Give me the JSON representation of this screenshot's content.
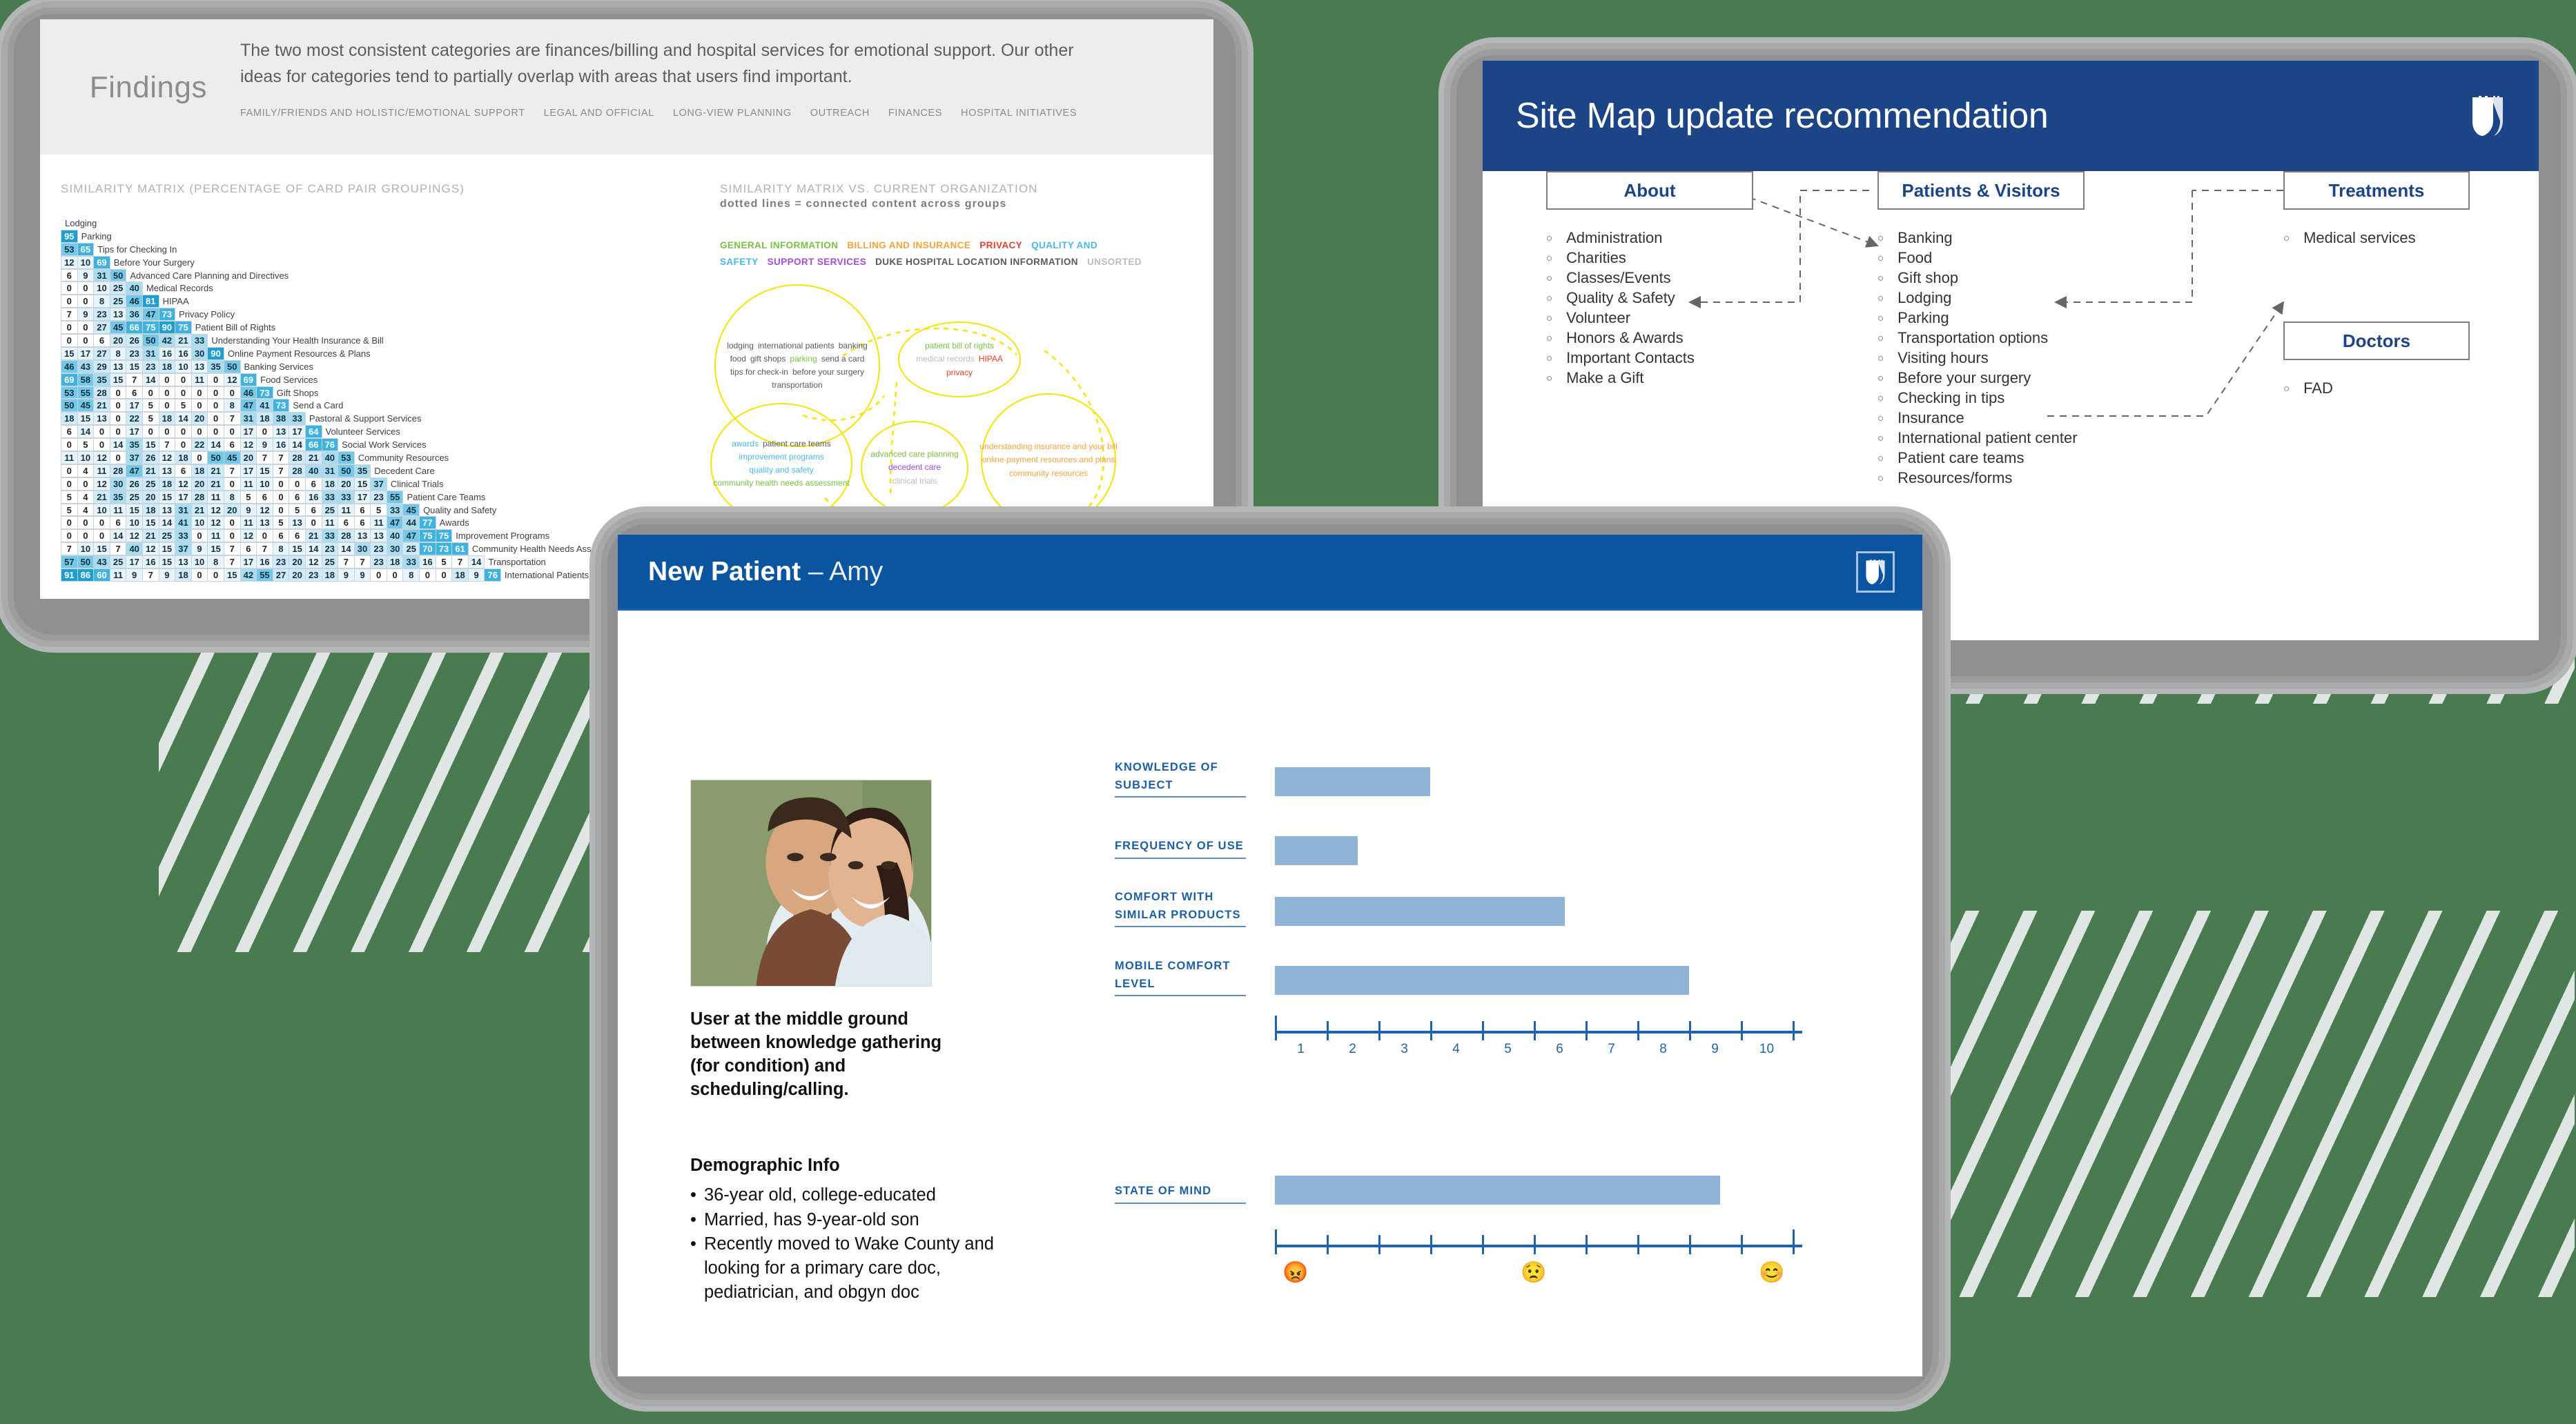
{
  "background": {
    "color": "#4a7a50",
    "stripe_color": "#ebeeee"
  },
  "panels": {
    "findings": {
      "title": "Findings",
      "paragraph": "The two most consistent categories are finances/billing and hospital services for emotional support. Our other ideas for categories tend to partially overlap with areas that users find important.",
      "categories": [
        "FAMILY/FRIENDS AND HOLISTIC/EMOTIONAL SUPPORT",
        "LEGAL AND OFFICIAL",
        "LONG-VIEW PLANNING",
        "OUTREACH",
        "FINANCES",
        "HOSPITAL INITIATIVES"
      ],
      "matrix_title": "SIMILARITY MATRIX (PERCENTAGE OF CARD PAIR GROUPINGS)",
      "bubble_title": "SIMILARITY MATRIX VS. CURRENT ORGANIZATION",
      "bubble_subtitle": "dotted lines = connected content across groups",
      "legend": [
        {
          "label": "GENERAL INFORMATION",
          "color": "#7ac143"
        },
        {
          "label": "BILLING AND INSURANCE",
          "color": "#f5a33c"
        },
        {
          "label": "PRIVACY",
          "color": "#e8402a"
        },
        {
          "label": "QUALITY AND SAFETY",
          "color": "#4ab9e8"
        },
        {
          "label": "SUPPORT SERVICES",
          "color": "#a44ad6"
        },
        {
          "label": "DUKE HOSPITAL LOCATION INFORMATION",
          "color": "#5a5a5a"
        },
        {
          "label": "UNSORTED",
          "color": "#bcbcbc"
        }
      ],
      "bubbles": [
        {
          "tags": [
            {
              "t": "lodging",
              "c": "#5a5a5a"
            },
            {
              "t": "international patients",
              "c": "#5a5a5a"
            },
            {
              "t": "banking",
              "c": "#5a5a5a"
            },
            {
              "t": "food",
              "c": "#5a5a5a"
            },
            {
              "t": "gift shops",
              "c": "#5a5a5a"
            },
            {
              "t": "parking",
              "c": "#7ac143"
            },
            {
              "t": "send a card",
              "c": "#5a5a5a"
            },
            {
              "t": "tips for check-in",
              "c": "#5a5a5a"
            },
            {
              "t": "before your surgery",
              "c": "#5a5a5a"
            },
            {
              "t": "transportation",
              "c": "#5a5a5a"
            }
          ]
        },
        {
          "tags": [
            {
              "t": "patient bill of rights",
              "c": "#7ac143"
            },
            {
              "t": "medical records",
              "c": "#bcbcbc"
            },
            {
              "t": "HIPAA",
              "c": "#e8402a"
            },
            {
              "t": "privacy",
              "c": "#e8402a"
            }
          ]
        },
        {
          "tags": [
            {
              "t": "awards",
              "c": "#4ab9e8"
            },
            {
              "t": "patient care teams",
              "c": "#5a5a5a"
            },
            {
              "t": "improvement programs",
              "c": "#4ab9e8"
            },
            {
              "t": "quality and safety",
              "c": "#4ab9e8"
            },
            {
              "t": "community health needs assessment",
              "c": "#7ac143"
            }
          ]
        },
        {
          "tags": [
            {
              "t": "advanced care planning",
              "c": "#7ac143"
            },
            {
              "t": "decedent care",
              "c": "#a44ad6"
            },
            {
              "t": "clinical trials",
              "c": "#bcbcbc"
            }
          ]
        },
        {
          "tags": [
            {
              "t": "understanding insurance and your bill",
              "c": "#f5a33c"
            },
            {
              "t": "online payment resources and plans",
              "c": "#f5a33c"
            },
            {
              "t": "community resources",
              "c": "#f5a33c"
            }
          ]
        }
      ],
      "matrix": {
        "labels": [
          "Lodging",
          "Parking",
          "Tips for Checking In",
          "Before Your Surgery",
          "Advanced Care Planning and Directives",
          "Medical Records",
          "HIPAA",
          "Privacy Policy",
          "Patient Bill of Rights",
          "Understanding Your Health Insurance & Bill",
          "Online Payment Resources & Plans",
          "Banking Services",
          "Food Services",
          "Gift Shops",
          "Send a Card",
          "Pastoral & Support Services",
          "Volunteer Services",
          "Social Work Services",
          "Community Resources",
          "Decedent Care",
          "Clinical Trials",
          "Patient Care Teams",
          "Quality and Safety",
          "Awards",
          "Improvement Programs",
          "Community Health Needs Assessment",
          "Transportation",
          "International Patients"
        ],
        "rows": [
          [],
          [
            95
          ],
          [
            53,
            65
          ],
          [
            12,
            10,
            69
          ],
          [
            6,
            9,
            31,
            50
          ],
          [
            0,
            0,
            10,
            25,
            40
          ],
          [
            0,
            0,
            8,
            25,
            46,
            81
          ],
          [
            7,
            9,
            23,
            13,
            36,
            47,
            73
          ],
          [
            0,
            0,
            27,
            45,
            66,
            75,
            90,
            75
          ],
          [
            0,
            0,
            6,
            20,
            26,
            50,
            42,
            21,
            33
          ],
          [
            15,
            17,
            27,
            8,
            23,
            31,
            16,
            16,
            30,
            90
          ],
          [
            46,
            43,
            29,
            13,
            15,
            23,
            18,
            10,
            13,
            35,
            50
          ],
          [
            69,
            58,
            35,
            15,
            7,
            14,
            0,
            0,
            11,
            0,
            12,
            69
          ],
          [
            53,
            55,
            28,
            0,
            6,
            0,
            0,
            0,
            0,
            0,
            0,
            46,
            73
          ],
          [
            50,
            45,
            21,
            0,
            17,
            5,
            0,
            5,
            0,
            0,
            8,
            47,
            41,
            73
          ],
          [
            18,
            15,
            13,
            0,
            22,
            5,
            18,
            14,
            20,
            0,
            7,
            31,
            18,
            38,
            33
          ],
          [
            6,
            14,
            0,
            0,
            17,
            0,
            0,
            0,
            0,
            0,
            0,
            17,
            0,
            13,
            17,
            64
          ],
          [
            0,
            5,
            0,
            14,
            35,
            15,
            7,
            0,
            22,
            14,
            6,
            12,
            9,
            16,
            14,
            66,
            76
          ],
          [
            11,
            10,
            12,
            0,
            37,
            26,
            12,
            18,
            0,
            50,
            45,
            20,
            7,
            7,
            28,
            21,
            40,
            53
          ],
          [
            0,
            4,
            11,
            28,
            47,
            21,
            13,
            6,
            18,
            21,
            7,
            17,
            15,
            7,
            28,
            40,
            31,
            50,
            35
          ],
          [
            0,
            0,
            12,
            30,
            26,
            25,
            18,
            12,
            20,
            21,
            0,
            11,
            10,
            0,
            0,
            6,
            18,
            20,
            15,
            37
          ],
          [
            5,
            4,
            21,
            35,
            25,
            20,
            15,
            17,
            28,
            11,
            8,
            5,
            6,
            0,
            6,
            16,
            33,
            33,
            17,
            23,
            55
          ],
          [
            5,
            4,
            10,
            11,
            15,
            18,
            13,
            31,
            21,
            12,
            20,
            9,
            12,
            0,
            5,
            6,
            25,
            11,
            6,
            5,
            33,
            45
          ],
          [
            0,
            0,
            0,
            6,
            10,
            15,
            14,
            41,
            10,
            12,
            0,
            11,
            13,
            5,
            13,
            0,
            11,
            6,
            6,
            11,
            47,
            44,
            77
          ],
          [
            0,
            0,
            0,
            14,
            12,
            21,
            25,
            33,
            0,
            11,
            0,
            12,
            0,
            6,
            6,
            21,
            33,
            28,
            13,
            13,
            40,
            47,
            75,
            75
          ],
          [
            7,
            10,
            15,
            7,
            40,
            12,
            15,
            37,
            9,
            15,
            7,
            6,
            7,
            8,
            15,
            14,
            23,
            14,
            30,
            23,
            30,
            25,
            70,
            73,
            61
          ],
          [
            57,
            50,
            43,
            25,
            17,
            16,
            15,
            13,
            10,
            8,
            7,
            17,
            16,
            23,
            20,
            12,
            25,
            7,
            7,
            23,
            18,
            33,
            16,
            5,
            7,
            14
          ],
          [
            91,
            86,
            60,
            11,
            9,
            7,
            9,
            18,
            0,
            0,
            15,
            42,
            55,
            27,
            20,
            23,
            18,
            9,
            9,
            0,
            0,
            8,
            0,
            0,
            18,
            9,
            76
          ]
        ]
      }
    },
    "sitemap": {
      "title": "Site Map update recommendation",
      "logo_icon": "duke-shield-icon",
      "columns": [
        {
          "header": "About",
          "items": [
            "Administration",
            "Charities",
            "Classes/Events",
            "Quality & Safety",
            "Volunteer",
            "Honors & Awards",
            "Important Contacts",
            "Make a Gift"
          ]
        },
        {
          "header": "Patients & Visitors",
          "items": [
            "Banking",
            "Food",
            "Gift shop",
            "Lodging",
            "Parking",
            "Transportation options",
            "Visiting hours",
            "Before your surgery",
            "Checking in tips",
            "Insurance",
            "International patient center",
            "Patient care teams",
            "Resources/forms"
          ]
        },
        {
          "header": "Treatments",
          "items": [
            "Medical services"
          ]
        },
        {
          "header": "Doctors",
          "items": [
            "FAD"
          ]
        }
      ]
    },
    "amy": {
      "header_bold": "New Patient",
      "header_dash": " – ",
      "header_name": "Amy",
      "logo_icon": "duke-shield-icon",
      "photo_alt": "smiling-couple-photo",
      "summary": "User at the middle ground between knowledge gathering (for condition) and scheduling/calling.",
      "demographic_title": "Demographic Info",
      "demographics": [
        "36-year old, college-educated",
        "Married, has 9-year-old son",
        "Recently moved to Wake County and looking for a primary care doc, pediatrician, and obgyn doc"
      ]
    }
  },
  "chart_data": [
    {
      "type": "bar",
      "title": "",
      "orientation": "horizontal",
      "categories": [
        "KNOWLEDGE OF SUBJECT",
        "FREQUENCY OF USE",
        "COMFORT WITH SIMILAR PRODUCTS",
        "MOBILE COMFORT LEVEL"
      ],
      "values": [
        3.0,
        1.6,
        5.6,
        8.0
      ],
      "xlabel": "",
      "ylabel": "",
      "xlim": [
        0,
        10
      ],
      "tick_labels": [
        "1",
        "2",
        "3",
        "4",
        "5",
        "6",
        "7",
        "8",
        "9",
        "10"
      ],
      "bar_color": "#8fb4d6",
      "axis_color": "#1f63ad",
      "grid": false,
      "legend": false
    },
    {
      "type": "bar",
      "title": "",
      "orientation": "horizontal",
      "categories": [
        "STATE OF MIND"
      ],
      "values": [
        8.6
      ],
      "xlabel": "",
      "ylabel": "",
      "xlim": [
        0,
        10
      ],
      "tick_labels": [],
      "scale_markers": [
        {
          "position": 0.4,
          "emoji": "😡",
          "name": "angry-face-emoji"
        },
        {
          "position": 5.0,
          "emoji": "😟",
          "name": "worried-face-emoji"
        },
        {
          "position": 9.6,
          "emoji": "😊",
          "name": "smiling-face-emoji"
        }
      ],
      "bar_color": "#8fb4d6",
      "axis_color": "#1f63ad",
      "grid": false,
      "legend": false
    }
  ]
}
